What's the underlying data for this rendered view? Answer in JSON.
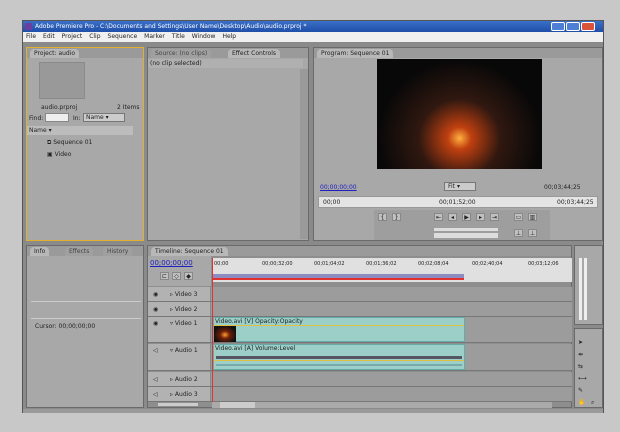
{
  "window": {
    "title": "Adobe Premiere Pro - C:\\Documents and Settings\\User Name\\Desktop\\Audio\\audio.prproj *"
  },
  "menu": [
    "File",
    "Edit",
    "Project",
    "Clip",
    "Sequence",
    "Marker",
    "Title",
    "Window",
    "Help"
  ],
  "project": {
    "tab": "Project: audio",
    "file": "audio.prproj",
    "count": "2 Items",
    "find_label": "Find:",
    "in_label": "In:",
    "in_value": "Name",
    "column": "Name",
    "items": [
      "Sequence 01",
      "Video"
    ]
  },
  "source": {
    "tab_source": "Source: (no clips)",
    "tab_effects": "Effect Controls",
    "no_clip": "(no clip selected)"
  },
  "program": {
    "tab": "Program: Sequence 01",
    "timecode": "00;00;00;00",
    "zoom": "Fit",
    "duration": "00;03;44;25",
    "ruler": [
      "00;00",
      "00;01;52;00",
      "00;03;44;25"
    ]
  },
  "info": {
    "tabs": [
      "Info",
      "Effects",
      "History"
    ],
    "cursor": "Cursor: 00;00;00;00"
  },
  "timeline": {
    "tab": "Timeline: Sequence 01",
    "timecode": "00;00;00;00",
    "ruler": [
      "00;00",
      "00;00;32;00",
      "00;01;04;02",
      "00;01;36;02",
      "00;02;08;04",
      "00;02;40;04",
      "00;03;12;06"
    ],
    "tracks": [
      "Video 3",
      "Video 2",
      "Video 1",
      "Audio 1",
      "Audio 2",
      "Audio 3"
    ],
    "video_clip": "Video.avi [V]  Opacity:Opacity",
    "audio_clip": "Video.avi [A]  Volume:Level"
  },
  "colors": {
    "panel_focus": "#e0b030",
    "playhead": "#e03030",
    "clip": "#9ccfc8",
    "timecode": "#2020c0"
  }
}
